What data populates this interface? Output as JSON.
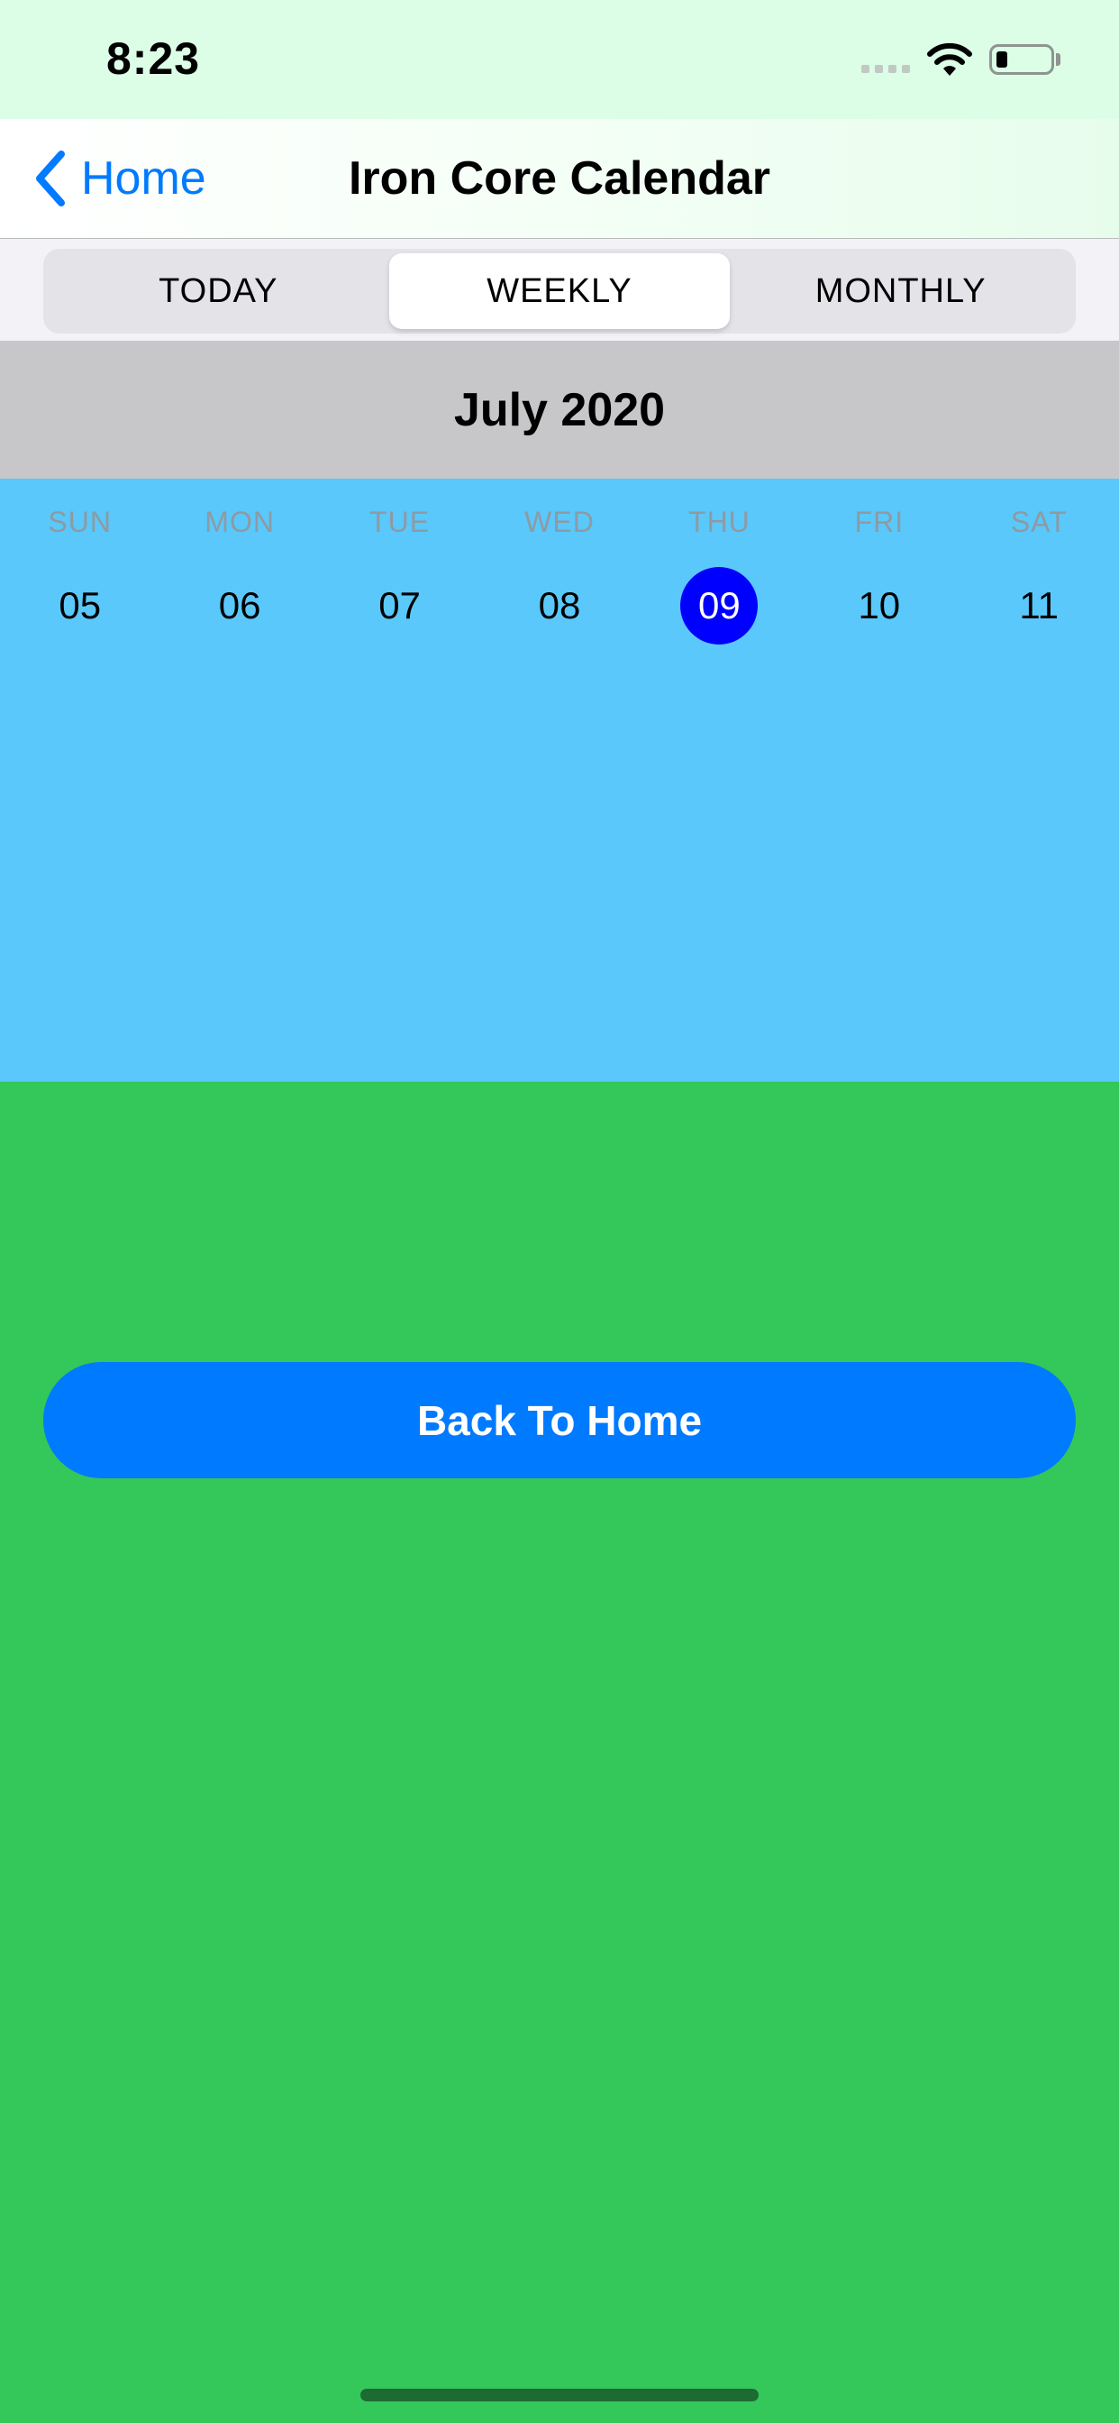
{
  "status_bar": {
    "time": "8:23"
  },
  "nav": {
    "back_label": "Home",
    "title": "Iron Core Calendar"
  },
  "segments": {
    "today": "TODAY",
    "weekly": "WEEKLY",
    "monthly": "MONTHLY",
    "selected": "WEEKLY"
  },
  "calendar": {
    "month_year": "July 2020",
    "weekdays": [
      "SUN",
      "MON",
      "TUE",
      "WED",
      "THU",
      "FRI",
      "SAT"
    ],
    "dates": [
      "05",
      "06",
      "07",
      "08",
      "09",
      "10",
      "11"
    ],
    "selected_date": "09"
  },
  "action": {
    "back_to_home_label": "Back To Home"
  },
  "colors": {
    "status_bg": "#dcfde6",
    "accent": "#007aff",
    "week_bg": "#5ac8fa",
    "page_bg": "#34c759",
    "selected_date": "#0000ff",
    "month_header_bg": "#c7c7c9"
  },
  "icons": {
    "back": "chevron-left-icon",
    "wifi": "wifi-icon",
    "battery": "battery-icon",
    "signal": "cellular-signal-icon"
  }
}
